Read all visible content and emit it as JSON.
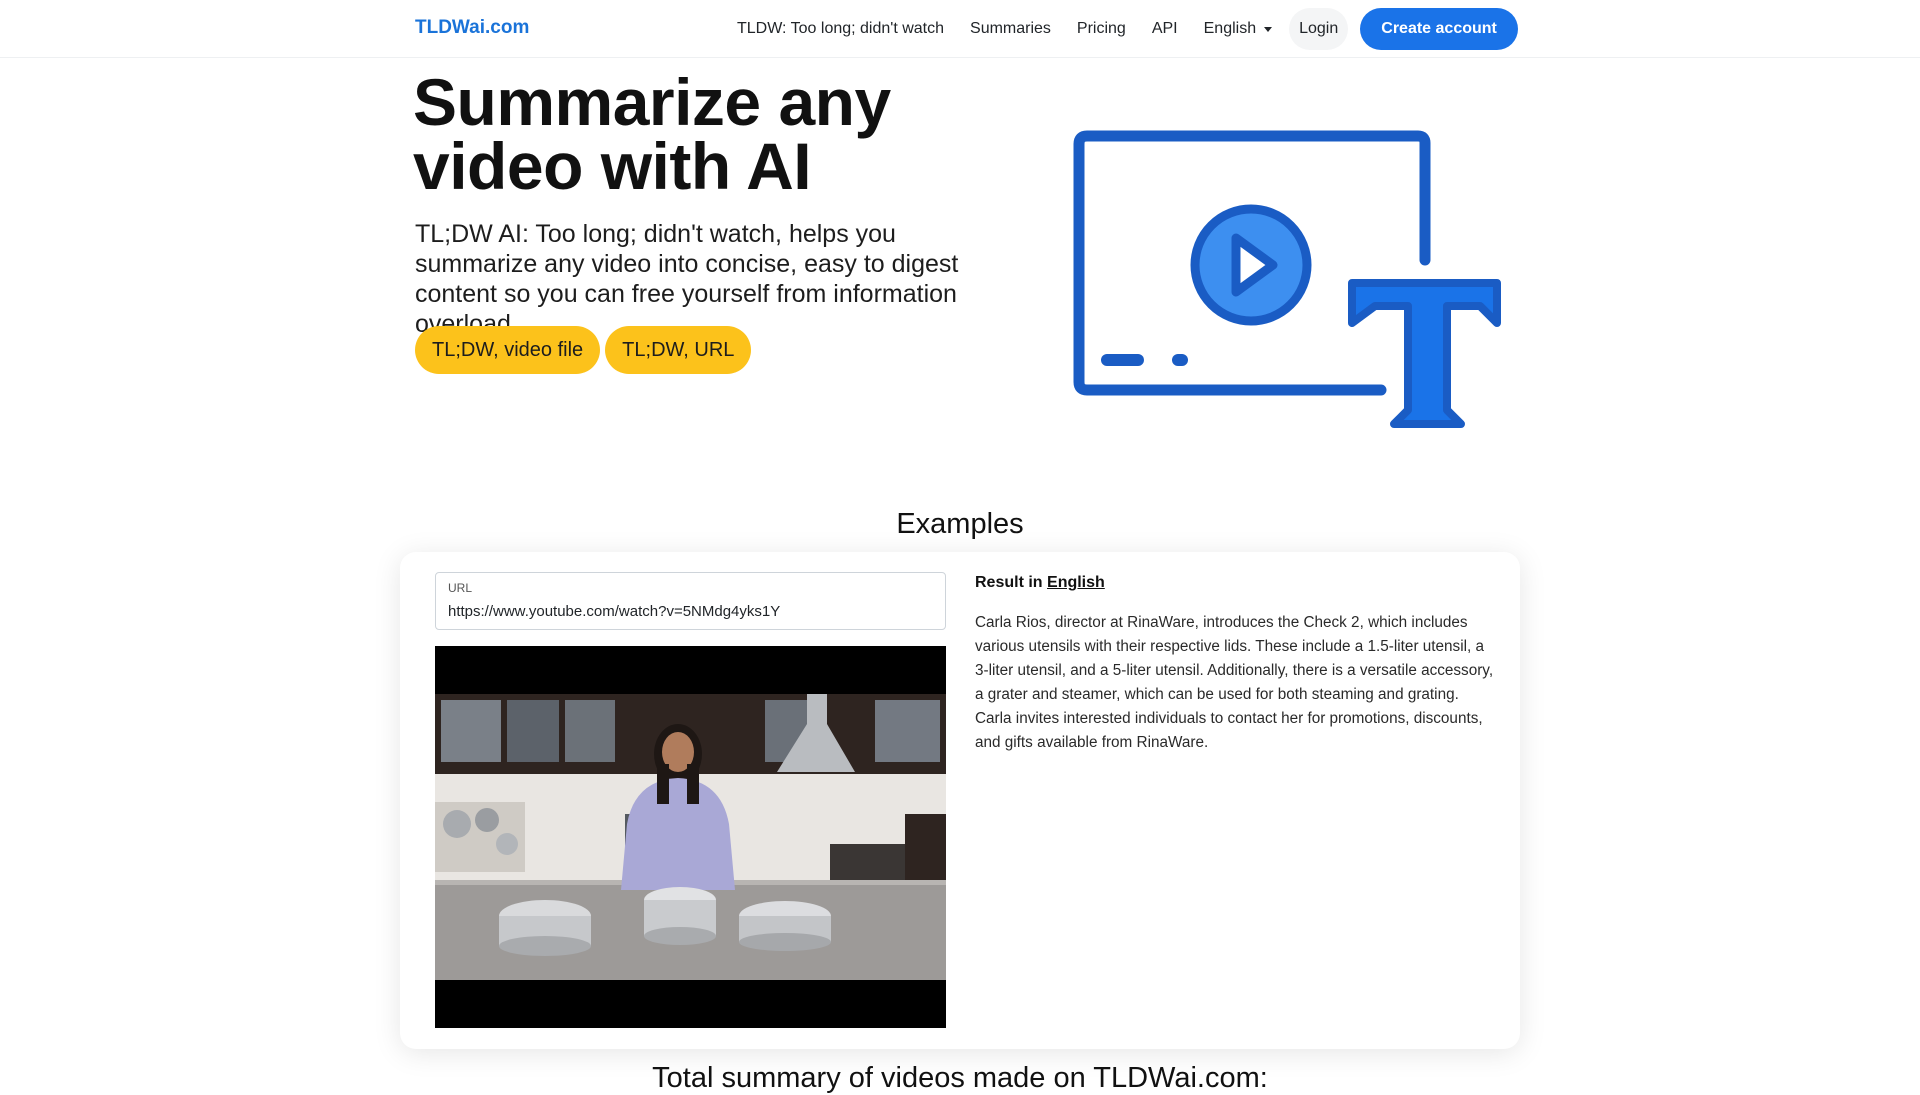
{
  "navbar": {
    "brand": "TLDWai.com",
    "links": {
      "tldw": "TLDW: Too long; didn't watch",
      "summaries": "Summaries",
      "pricing": "Pricing",
      "api": "API",
      "language": "English"
    },
    "login_label": "Login",
    "create_account_label": "Create account"
  },
  "hero": {
    "title_line1": "Summarize any",
    "title_line2": "video with AI",
    "subtitle": "TL;DW AI: Too long; didn't watch, helps you summarize any video into concise, easy to digest content so you can free yourself from information overload.",
    "buttons": {
      "video_file": "TL;DW, video file",
      "url": "TL;DW, URL"
    },
    "illustration_icons": [
      "monitor-play-icon",
      "text-t-icon"
    ]
  },
  "examples": {
    "heading": "Examples",
    "url_label": "URL",
    "url_value": "https://www.youtube.com/watch?v=5NMdg4yks1Y",
    "result_prefix": "Result in",
    "result_language": "English",
    "result_text": "Carla Rios, director at RinaWare, introduces the Check 2, which includes various utensils with their respective lids. These include a 1.5-liter utensil, a 3-liter utensil, and a 5-liter utensil. Additionally, there is a versatile accessory, a grater and steamer, which can be used for both steaming and grating. Carla invites interested individuals to contact her for promotions, discounts, and gifts available from RinaWare."
  },
  "total_heading": "Total summary of videos made on TLDWai.com:",
  "colors": {
    "brand_blue": "#1a73e8",
    "accent_yellow": "#fcc21b",
    "illustration_blue": "#1a5cc4",
    "illustration_light": "#3d8ff0"
  }
}
